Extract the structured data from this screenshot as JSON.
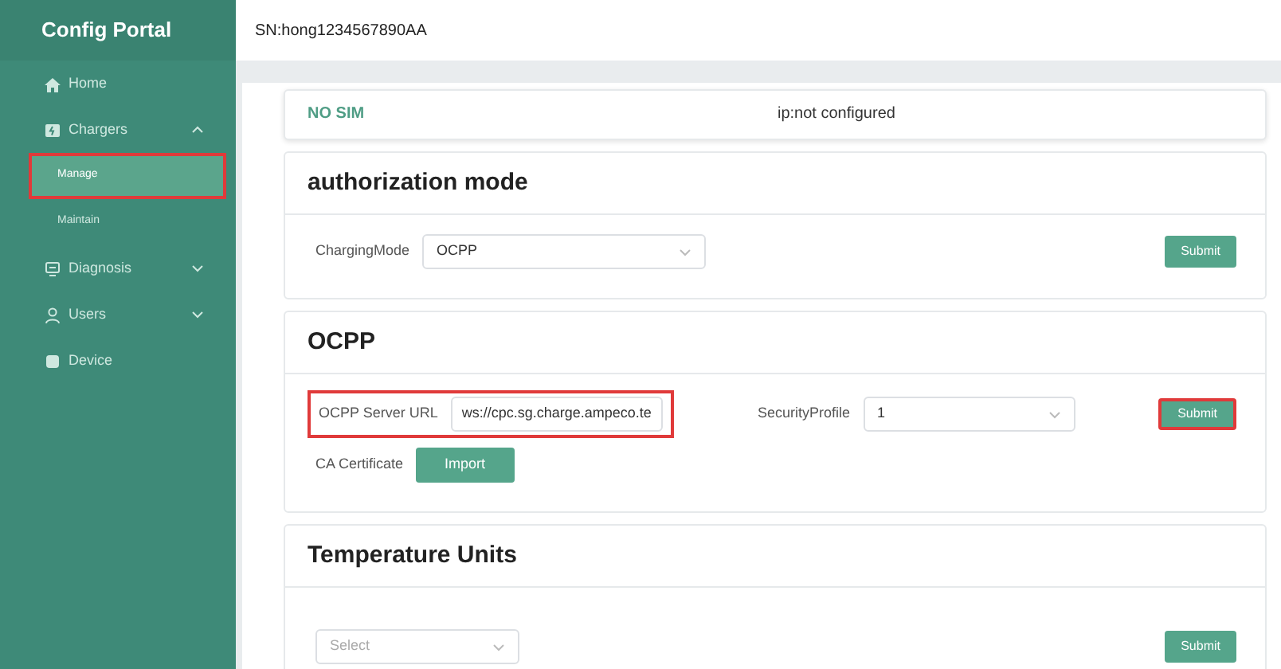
{
  "sidebar": {
    "title": "Config Portal",
    "items": [
      {
        "kind": "top",
        "label": "Home",
        "selected": false,
        "highlighted": false
      },
      {
        "kind": "top",
        "label": "Chargers",
        "expanded": true,
        "selected": false,
        "highlighted": false
      },
      {
        "kind": "sub",
        "label": "Manage",
        "selected": true,
        "highlighted": true
      },
      {
        "kind": "sub",
        "label": "Maintain",
        "selected": false,
        "highlighted": false
      },
      {
        "kind": "top",
        "label": "Diagnosis",
        "expanded": false,
        "selected": false,
        "highlighted": false
      },
      {
        "kind": "top",
        "label": "Users",
        "expanded": false,
        "selected": false,
        "highlighted": false
      },
      {
        "kind": "top",
        "label": "Device",
        "selected": false,
        "highlighted": false
      }
    ]
  },
  "header": {
    "serial": "SN:hong1234567890AA"
  },
  "status_card": {
    "sim": "NO SIM",
    "ip": "ip:not configured"
  },
  "cards": [
    {
      "title": "authorization mode",
      "rows": [
        [
          {
            "kind": "select",
            "label": "ChargingMode",
            "value": "OCPP",
            "highlighted": false
          },
          {
            "kind": "submit",
            "label": "Submit",
            "highlighted": false
          }
        ]
      ]
    },
    {
      "title": "OCPP",
      "rows": [
        [
          {
            "kind": "text",
            "label": "OCPP Server URL",
            "value": "ws://cpc.sg.charge.ampeco.te",
            "highlighted": true
          },
          {
            "kind": "select",
            "label": "SecurityProfile",
            "value": "1",
            "highlighted": false
          },
          {
            "kind": "submit",
            "label": "Submit",
            "highlighted": true
          }
        ],
        [
          {
            "kind": "import",
            "label": "CA Certificate",
            "button": "Import",
            "highlighted": false
          }
        ]
      ]
    },
    {
      "title": "Temperature Units",
      "rows": [
        [
          {
            "kind": "select",
            "placeholder": "Select",
            "highlighted": false
          },
          {
            "kind": "submit",
            "label": "Submit",
            "highlighted": false
          }
        ]
      ]
    }
  ]
}
